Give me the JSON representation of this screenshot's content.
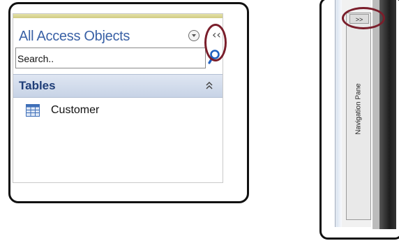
{
  "expanded_pane": {
    "title": "All Access Objects",
    "dropdown_icon": "circle-chevron-down-icon",
    "collapse_label": "‹‹",
    "search": {
      "value": "Search..",
      "icon": "magnifier-icon"
    },
    "group": {
      "title": "Tables",
      "chevron": "double-chevron-up-icon"
    },
    "objects": [
      {
        "label": "Customer",
        "icon": "table-icon"
      }
    ]
  },
  "collapsed_pane": {
    "expand_label": ">>",
    "vertical_label": "Navigation Pane"
  },
  "colors": {
    "title_blue": "#3a61a6",
    "group_blue": "#1f3e78",
    "highlight": "#7a1e2b",
    "header_stripe": "#cfcb84"
  }
}
